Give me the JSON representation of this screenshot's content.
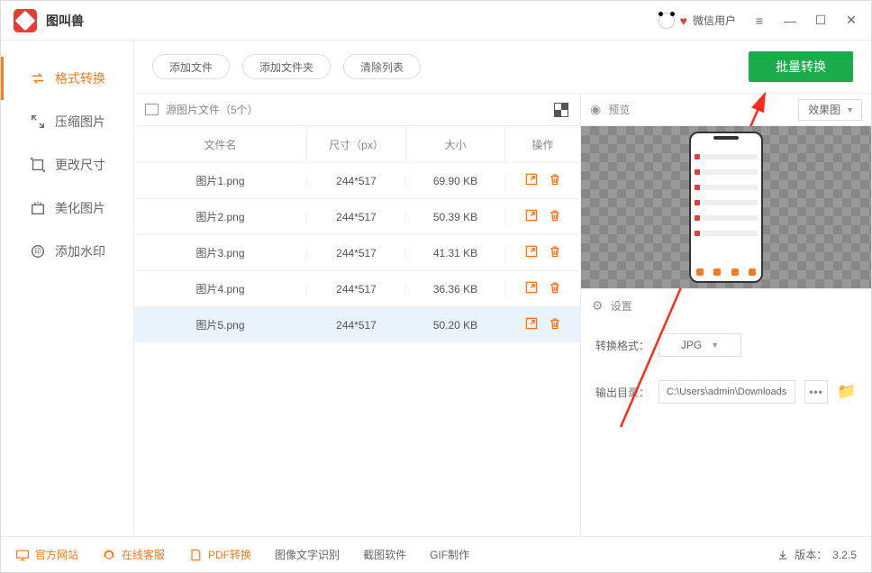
{
  "app": {
    "title": "图叫兽",
    "user": "微信用户"
  },
  "sidebar": {
    "items": [
      {
        "label": "格式转换"
      },
      {
        "label": "压缩图片"
      },
      {
        "label": "更改尺寸"
      },
      {
        "label": "美化图片"
      },
      {
        "label": "添加水印"
      }
    ]
  },
  "toolbar": {
    "add_file": "添加文件",
    "add_folder": "添加文件夹",
    "clear": "清除列表",
    "batch_convert": "批量转换"
  },
  "source": {
    "title": "源图片文件（5个）",
    "cols": {
      "name": "文件名",
      "dim": "尺寸（px）",
      "size": "大小",
      "ops": "操作"
    },
    "rows": [
      {
        "name": "图片1.png",
        "dim": "244*517",
        "size": "69.90 KB"
      },
      {
        "name": "图片2.png",
        "dim": "244*517",
        "size": "50.39 KB"
      },
      {
        "name": "图片3.png",
        "dim": "244*517",
        "size": "41.31 KB"
      },
      {
        "name": "图片4.png",
        "dim": "244*517",
        "size": "36.36 KB"
      },
      {
        "name": "图片5.png",
        "dim": "244*517",
        "size": "50.20 KB"
      }
    ]
  },
  "preview": {
    "title": "预览",
    "dropdown": "效果图"
  },
  "settings": {
    "title": "设置",
    "format_label": "转换格式：",
    "format_value": "JPG",
    "outdir_label": "输出目录：",
    "outdir_value": "C:\\Users\\admin\\Downloads"
  },
  "footer": {
    "site": "官方网站",
    "support": "在线客服",
    "pdf": "PDF转换",
    "ocr": "图像文字识别",
    "screenshot": "截图软件",
    "gif": "GIF制作",
    "version_label": "版本：",
    "version": "3.2.5"
  }
}
